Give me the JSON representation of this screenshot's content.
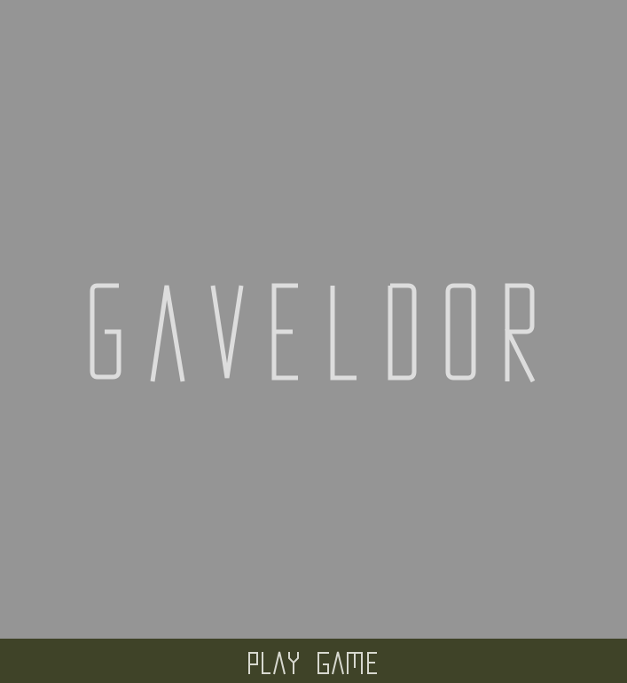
{
  "game": {
    "title": "GAVELDOR",
    "play_label": "PLAY GAME"
  },
  "colors": {
    "background": "#959595",
    "title_text": "#dddddd",
    "play_bar": "#3f4328",
    "play_text": "#d7d8cf"
  }
}
